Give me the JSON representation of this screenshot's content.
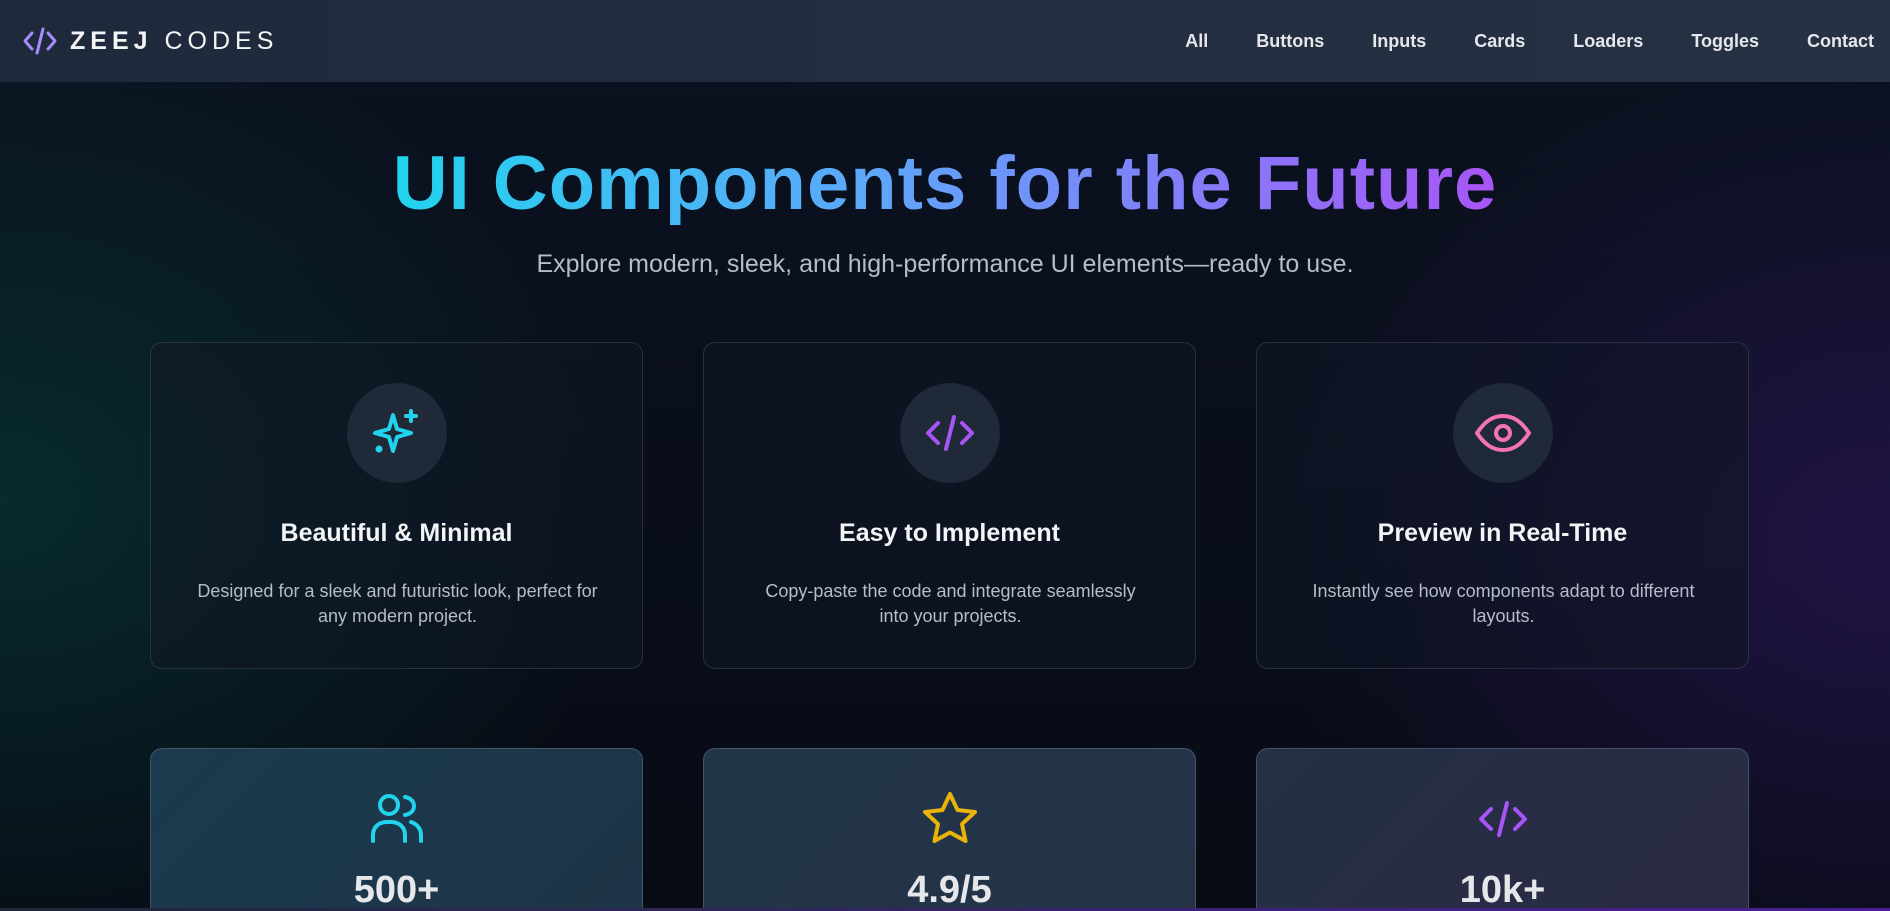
{
  "brand": {
    "bold": "ZEEJ",
    "light": "CODES",
    "logo_icon": "code-icon"
  },
  "nav": {
    "items": [
      "All",
      "Buttons",
      "Inputs",
      "Cards",
      "Loaders",
      "Toggles",
      "Contact"
    ]
  },
  "hero": {
    "title": "UI Components for the Future",
    "subtitle": "Explore modern, sleek, and high-performance UI elements—ready to use."
  },
  "features": [
    {
      "icon": "sparkles-icon",
      "title": "Beautiful & Minimal",
      "description": "Designed for a sleek and futuristic look, perfect for any modern project.",
      "color": "#22d3ee"
    },
    {
      "icon": "code-icon",
      "title": "Easy to Implement",
      "description": "Copy-paste the code and integrate seamlessly into your projects.",
      "color": "#a855f7"
    },
    {
      "icon": "eye-icon",
      "title": "Preview in Real-Time",
      "description": "Instantly see how components adapt to different layouts.",
      "color": "#f472b6"
    }
  ],
  "stats": [
    {
      "icon": "users-icon",
      "value": "500+",
      "color": "#22d3ee"
    },
    {
      "icon": "star-icon",
      "value": "4.9/5",
      "color": "#eab308"
    },
    {
      "icon": "code-icon",
      "value": "10k+",
      "color": "#a855f7"
    }
  ],
  "colors": {
    "accent_cyan": "#22d3ee",
    "accent_purple": "#a855f7",
    "navbar_bg": "#263244"
  }
}
